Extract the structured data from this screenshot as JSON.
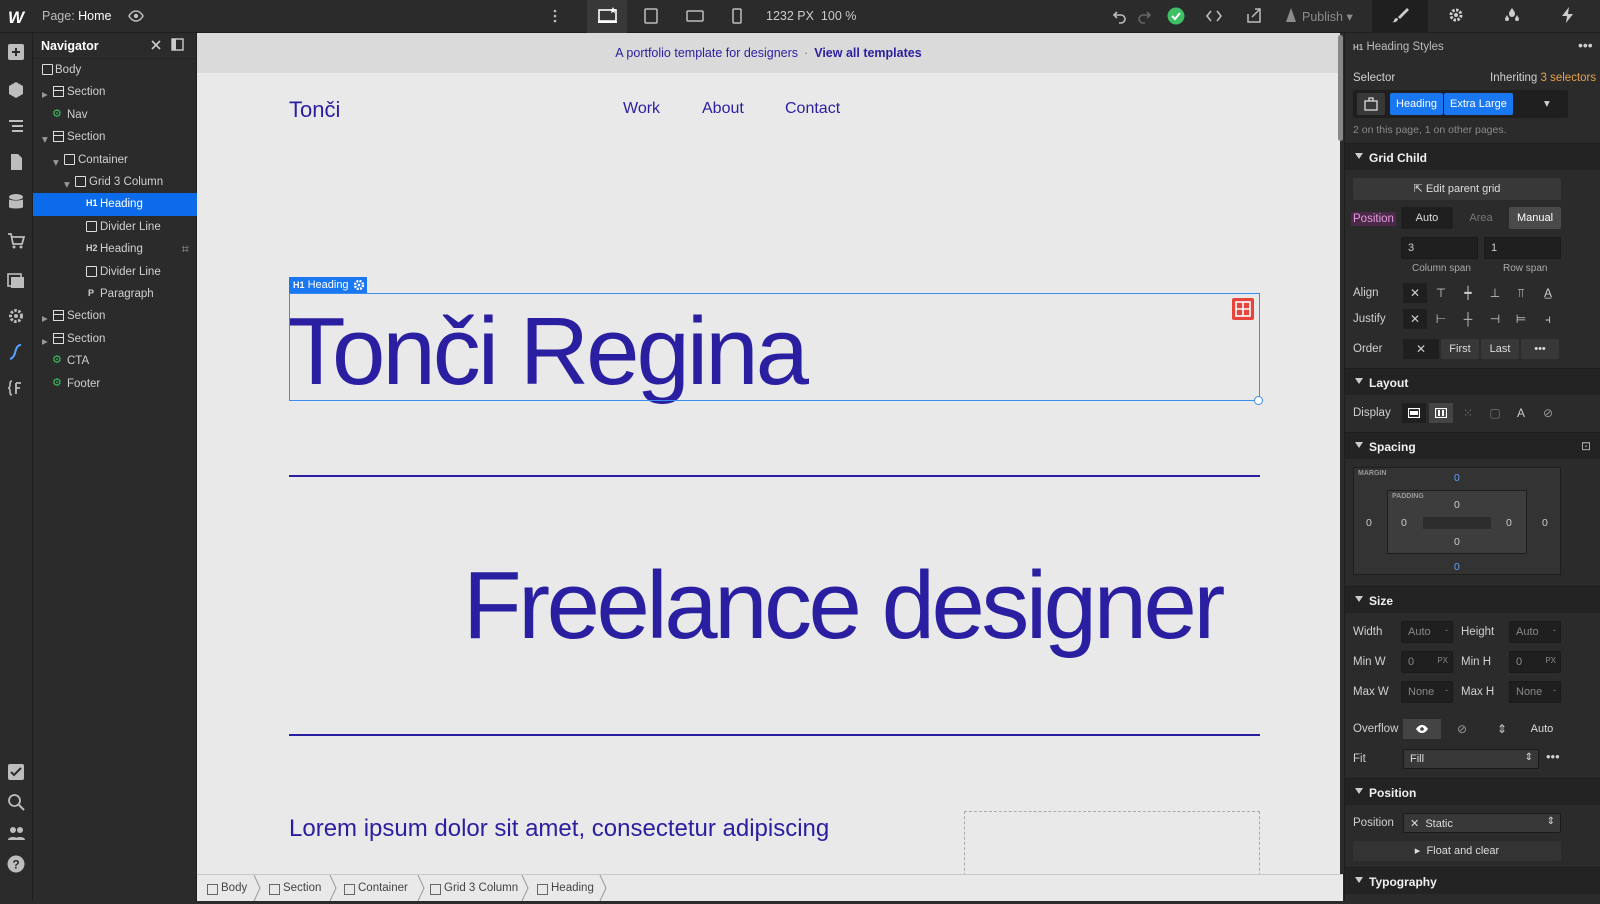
{
  "topbar": {
    "logo": "W",
    "page_label": "Page:",
    "page_name": "Home",
    "canvas_width": "1232 PX",
    "zoom": "100 %",
    "publish": "Publish"
  },
  "navigator": {
    "title": "Navigator",
    "items": [
      {
        "label": "Body"
      },
      {
        "label": "Section"
      },
      {
        "label": "Nav"
      },
      {
        "label": "Section"
      },
      {
        "label": "Container"
      },
      {
        "label": "Grid 3 Column"
      },
      {
        "label": "Heading",
        "tag": "H1"
      },
      {
        "label": "Divider Line"
      },
      {
        "label": "Heading",
        "tag": "H2"
      },
      {
        "label": "Divider Line"
      },
      {
        "label": "Paragraph",
        "tag": "P"
      },
      {
        "label": "Section"
      },
      {
        "label": "Section"
      },
      {
        "label": "CTA"
      },
      {
        "label": "Footer"
      }
    ]
  },
  "canvas": {
    "banner_text": "A portfolio template for designers",
    "banner_sep": "·",
    "banner_link": "View all templates",
    "site_logo": "Tonči",
    "nav_links": [
      "Work",
      "About",
      "Contact"
    ],
    "selected_tag": "H1",
    "selected_label": "Heading",
    "heading1": "Tonči Regina",
    "heading2": "Freelance designer",
    "paragraph": "Lorem ipsum dolor sit amet, consectetur adipiscing"
  },
  "breadcrumbs": [
    "Body",
    "Section",
    "Container",
    "Grid 3 Column",
    "Heading"
  ],
  "style_panel": {
    "header_tag": "H1",
    "header_title": "Heading Styles",
    "selector_label": "Selector",
    "inheriting_prefix": "Inheriting",
    "inheriting_count": "3 selectors",
    "selector_tags": [
      "Heading",
      "Extra Large"
    ],
    "usage_note": "2 on this page, 1 on other pages.",
    "grid_child": {
      "title": "Grid Child",
      "edit_parent_grid": "Edit parent grid",
      "position_label": "Position",
      "position_options": [
        "Auto",
        "Area",
        "Manual"
      ],
      "column_span_value": "3",
      "row_span_value": "1",
      "column_span_label": "Column span",
      "row_span_label": "Row span",
      "align_label": "Align",
      "justify_label": "Justify",
      "order_label": "Order",
      "order_options": [
        "First",
        "Last"
      ]
    },
    "layout": {
      "title": "Layout",
      "display_label": "Display"
    },
    "spacing": {
      "title": "Spacing",
      "margin_label": "MARGIN",
      "padding_label": "PADDING",
      "margin": {
        "top": "0",
        "right": "0",
        "bottom": "0",
        "left": "0"
      },
      "padding": {
        "top": "0",
        "right": "0",
        "bottom": "0",
        "left": "0"
      }
    },
    "size": {
      "title": "Size",
      "width_label": "Width",
      "width_value": "Auto",
      "height_label": "Height",
      "height_value": "Auto",
      "min_w_label": "Min W",
      "min_w_value": "0",
      "min_w_unit": "PX",
      "min_h_label": "Min H",
      "min_h_value": "0",
      "min_h_unit": "PX",
      "max_w_label": "Max W",
      "max_w_value": "None",
      "max_h_label": "Max H",
      "max_h_value": "None",
      "overflow_label": "Overflow",
      "overflow_auto": "Auto",
      "fit_label": "Fit",
      "fit_value": "Fill"
    },
    "position": {
      "title": "Position",
      "position_label": "Position",
      "position_value": "Static",
      "float_and_clear": "Float and clear"
    },
    "typography": {
      "title": "Typography"
    }
  },
  "colors": {
    "accent_blue": "#1a77f2",
    "brand_indigo": "#2a1fa0",
    "publish_ok_green": "#3fbf64",
    "orange_highlight": "#e8a24a"
  }
}
